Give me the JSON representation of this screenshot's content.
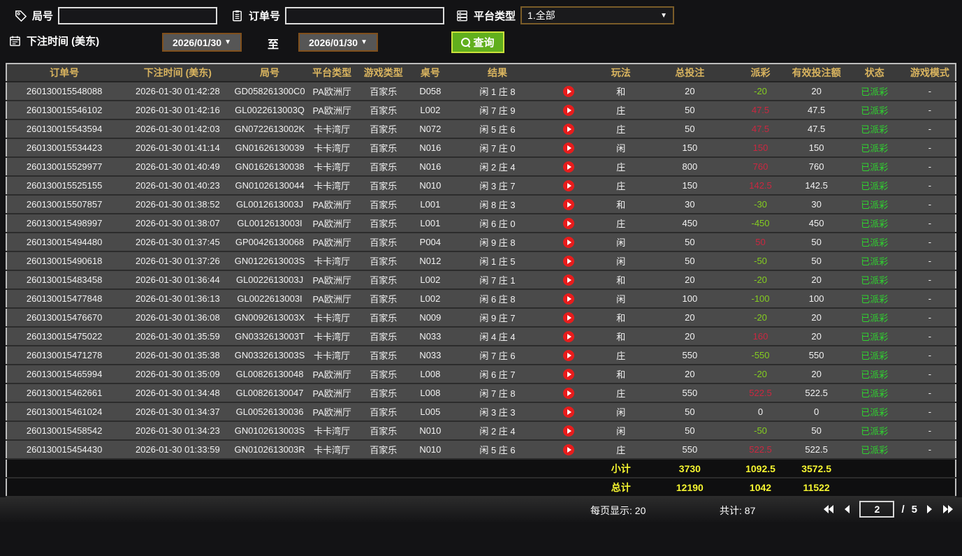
{
  "filters": {
    "round_label": "局号",
    "order_label": "订单号",
    "platform_label": "平台类型",
    "platform_value": "1.全部",
    "bet_time_label": "下注时间 (美东)",
    "date_from": "2026/01/30",
    "date_to": "2026/01/30",
    "to_label": "至",
    "search_label": "查询",
    "caret": "▼"
  },
  "table": {
    "columns": [
      "订单号",
      "下注时间 (美东)",
      "局号",
      "平台类型",
      "游戏类型",
      "桌号",
      "结果",
      "",
      "玩法",
      "总投注",
      "派彩",
      "有效投注额",
      "状态",
      "游戏模式"
    ],
    "rows": [
      {
        "order": "260130015548088",
        "time": "2026-01-30 01:42:28",
        "round": "GD058261300C0",
        "platform": "PA欧洲厅",
        "game": "百家乐",
        "table_no": "D058",
        "result": "闲 1 庄 8",
        "bet_type": "和",
        "total_bet": "20",
        "payout": "-20",
        "payout_sign": "neg",
        "valid_bet": "20",
        "status": "已派彩",
        "mode": "-"
      },
      {
        "order": "260130015546102",
        "time": "2026-01-30 01:42:16",
        "round": "GL0022613003Q",
        "platform": "PA欧洲厅",
        "game": "百家乐",
        "table_no": "L002",
        "result": "闲 7 庄 9",
        "bet_type": "庄",
        "total_bet": "50",
        "payout": "47.5",
        "payout_sign": "pos",
        "valid_bet": "47.5",
        "status": "已派彩",
        "mode": "-"
      },
      {
        "order": "260130015543594",
        "time": "2026-01-30 01:42:03",
        "round": "GN0722613002K",
        "platform": "卡卡湾厅",
        "game": "百家乐",
        "table_no": "N072",
        "result": "闲 5 庄 6",
        "bet_type": "庄",
        "total_bet": "50",
        "payout": "47.5",
        "payout_sign": "pos",
        "valid_bet": "47.5",
        "status": "已派彩",
        "mode": "-"
      },
      {
        "order": "260130015534423",
        "time": "2026-01-30 01:41:14",
        "round": "GN01626130039",
        "platform": "卡卡湾厅",
        "game": "百家乐",
        "table_no": "N016",
        "result": "闲 7 庄 0",
        "bet_type": "闲",
        "total_bet": "150",
        "payout": "150",
        "payout_sign": "pos",
        "valid_bet": "150",
        "status": "已派彩",
        "mode": "-"
      },
      {
        "order": "260130015529977",
        "time": "2026-01-30 01:40:49",
        "round": "GN01626130038",
        "platform": "卡卡湾厅",
        "game": "百家乐",
        "table_no": "N016",
        "result": "闲 2 庄 4",
        "bet_type": "庄",
        "total_bet": "800",
        "payout": "760",
        "payout_sign": "pos",
        "valid_bet": "760",
        "status": "已派彩",
        "mode": "-"
      },
      {
        "order": "260130015525155",
        "time": "2026-01-30 01:40:23",
        "round": "GN01026130044",
        "platform": "卡卡湾厅",
        "game": "百家乐",
        "table_no": "N010",
        "result": "闲 3 庄 7",
        "bet_type": "庄",
        "total_bet": "150",
        "payout": "142.5",
        "payout_sign": "pos",
        "valid_bet": "142.5",
        "status": "已派彩",
        "mode": "-"
      },
      {
        "order": "260130015507857",
        "time": "2026-01-30 01:38:52",
        "round": "GL0012613003J",
        "platform": "PA欧洲厅",
        "game": "百家乐",
        "table_no": "L001",
        "result": "闲 8 庄 3",
        "bet_type": "和",
        "total_bet": "30",
        "payout": "-30",
        "payout_sign": "neg",
        "valid_bet": "30",
        "status": "已派彩",
        "mode": "-"
      },
      {
        "order": "260130015498997",
        "time": "2026-01-30 01:38:07",
        "round": "GL0012613003I",
        "platform": "PA欧洲厅",
        "game": "百家乐",
        "table_no": "L001",
        "result": "闲 6 庄 0",
        "bet_type": "庄",
        "total_bet": "450",
        "payout": "-450",
        "payout_sign": "neg",
        "valid_bet": "450",
        "status": "已派彩",
        "mode": "-"
      },
      {
        "order": "260130015494480",
        "time": "2026-01-30 01:37:45",
        "round": "GP00426130068",
        "platform": "PA欧洲厅",
        "game": "百家乐",
        "table_no": "P004",
        "result": "闲 9 庄 8",
        "bet_type": "闲",
        "total_bet": "50",
        "payout": "50",
        "payout_sign": "pos",
        "valid_bet": "50",
        "status": "已派彩",
        "mode": "-"
      },
      {
        "order": "260130015490618",
        "time": "2026-01-30 01:37:26",
        "round": "GN0122613003S",
        "platform": "卡卡湾厅",
        "game": "百家乐",
        "table_no": "N012",
        "result": "闲 1 庄 5",
        "bet_type": "闲",
        "total_bet": "50",
        "payout": "-50",
        "payout_sign": "neg",
        "valid_bet": "50",
        "status": "已派彩",
        "mode": "-"
      },
      {
        "order": "260130015483458",
        "time": "2026-01-30 01:36:44",
        "round": "GL0022613003J",
        "platform": "PA欧洲厅",
        "game": "百家乐",
        "table_no": "L002",
        "result": "闲 7 庄 1",
        "bet_type": "和",
        "total_bet": "20",
        "payout": "-20",
        "payout_sign": "neg",
        "valid_bet": "20",
        "status": "已派彩",
        "mode": "-"
      },
      {
        "order": "260130015477848",
        "time": "2026-01-30 01:36:13",
        "round": "GL0022613003I",
        "platform": "PA欧洲厅",
        "game": "百家乐",
        "table_no": "L002",
        "result": "闲 6 庄 8",
        "bet_type": "闲",
        "total_bet": "100",
        "payout": "-100",
        "payout_sign": "neg",
        "valid_bet": "100",
        "status": "已派彩",
        "mode": "-"
      },
      {
        "order": "260130015476670",
        "time": "2026-01-30 01:36:08",
        "round": "GN0092613003X",
        "platform": "卡卡湾厅",
        "game": "百家乐",
        "table_no": "N009",
        "result": "闲 9 庄 7",
        "bet_type": "和",
        "total_bet": "20",
        "payout": "-20",
        "payout_sign": "neg",
        "valid_bet": "20",
        "status": "已派彩",
        "mode": "-"
      },
      {
        "order": "260130015475022",
        "time": "2026-01-30 01:35:59",
        "round": "GN0332613003T",
        "platform": "卡卡湾厅",
        "game": "百家乐",
        "table_no": "N033",
        "result": "闲 4 庄 4",
        "bet_type": "和",
        "total_bet": "20",
        "payout": "160",
        "payout_sign": "pos",
        "valid_bet": "20",
        "status": "已派彩",
        "mode": "-"
      },
      {
        "order": "260130015471278",
        "time": "2026-01-30 01:35:38",
        "round": "GN0332613003S",
        "platform": "卡卡湾厅",
        "game": "百家乐",
        "table_no": "N033",
        "result": "闲 7 庄 6",
        "bet_type": "庄",
        "total_bet": "550",
        "payout": "-550",
        "payout_sign": "neg",
        "valid_bet": "550",
        "status": "已派彩",
        "mode": "-"
      },
      {
        "order": "260130015465994",
        "time": "2026-01-30 01:35:09",
        "round": "GL00826130048",
        "platform": "PA欧洲厅",
        "game": "百家乐",
        "table_no": "L008",
        "result": "闲 6 庄 7",
        "bet_type": "和",
        "total_bet": "20",
        "payout": "-20",
        "payout_sign": "neg",
        "valid_bet": "20",
        "status": "已派彩",
        "mode": "-"
      },
      {
        "order": "260130015462661",
        "time": "2026-01-30 01:34:48",
        "round": "GL00826130047",
        "platform": "PA欧洲厅",
        "game": "百家乐",
        "table_no": "L008",
        "result": "闲 7 庄 8",
        "bet_type": "庄",
        "total_bet": "550",
        "payout": "522.5",
        "payout_sign": "pos",
        "valid_bet": "522.5",
        "status": "已派彩",
        "mode": "-"
      },
      {
        "order": "260130015461024",
        "time": "2026-01-30 01:34:37",
        "round": "GL00526130036",
        "platform": "PA欧洲厅",
        "game": "百家乐",
        "table_no": "L005",
        "result": "闲 3 庄 3",
        "bet_type": "闲",
        "total_bet": "50",
        "payout": "0",
        "payout_sign": "zero",
        "valid_bet": "0",
        "status": "已派彩",
        "mode": "-"
      },
      {
        "order": "260130015458542",
        "time": "2026-01-30 01:34:23",
        "round": "GN0102613003S",
        "platform": "卡卡湾厅",
        "game": "百家乐",
        "table_no": "N010",
        "result": "闲 2 庄 4",
        "bet_type": "闲",
        "total_bet": "50",
        "payout": "-50",
        "payout_sign": "neg",
        "valid_bet": "50",
        "status": "已派彩",
        "mode": "-"
      },
      {
        "order": "260130015454430",
        "time": "2026-01-30 01:33:59",
        "round": "GN0102613003R",
        "platform": "卡卡湾厅",
        "game": "百家乐",
        "table_no": "N010",
        "result": "闲 5 庄 6",
        "bet_type": "庄",
        "total_bet": "550",
        "payout": "522.5",
        "payout_sign": "pos",
        "valid_bet": "522.5",
        "status": "已派彩",
        "mode": "-"
      }
    ],
    "subtotal": {
      "label": "小计",
      "total_bet": "3730",
      "payout": "1092.5",
      "valid_bet": "3572.5"
    },
    "total": {
      "label": "总计",
      "total_bet": "12190",
      "payout": "1042",
      "valid_bet": "11522"
    }
  },
  "footer": {
    "per_page": "每页显示: 20",
    "total_count": "共计: 87",
    "page": "2",
    "slash": "/",
    "pages": "5"
  },
  "colors": {
    "header_text": "#d9b45f",
    "row_bg": "#4a4a4a",
    "payout_positive": "#cb2740",
    "payout_negative": "#84cd20",
    "status_paid": "#2fd32f",
    "summary_text": "#f6f630",
    "search_button_bg": "#61af1d",
    "play_icon_bg": "#e81c1c",
    "date_border": "#80501c"
  }
}
